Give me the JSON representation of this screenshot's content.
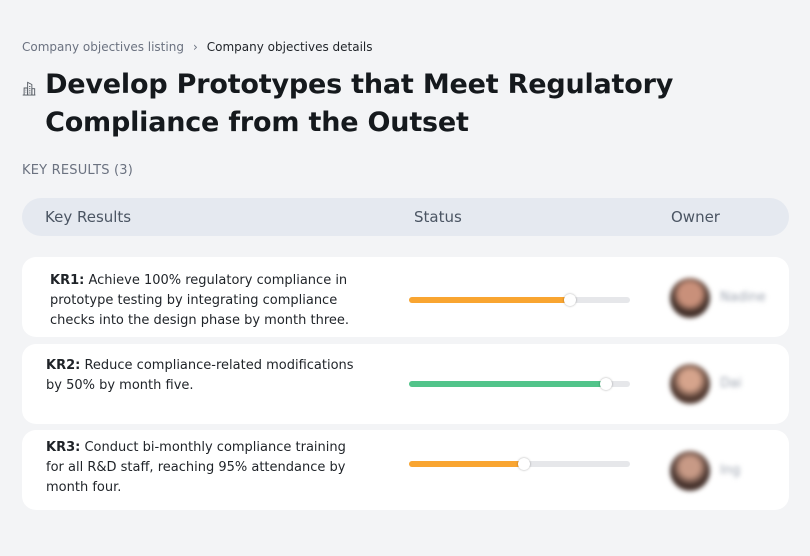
{
  "breadcrumb": {
    "parent": "Company objectives listing",
    "separator": "›",
    "current": "Company objectives details"
  },
  "objective": {
    "icon": "buildings-icon",
    "title": "Develop Prototypes that Meet Regulatory Compliance from the Outset"
  },
  "key_results_label": "KEY RESULTS (3)",
  "table": {
    "headers": {
      "key_results": "Key Results",
      "status": "Status",
      "owner": "Owner"
    },
    "rows": [
      {
        "id": "KR1:",
        "text": "Achieve 100% regulatory compliance in prototype testing by integrating compliance checks into the design phase by month three.",
        "progress": 0.73,
        "status_color": "#f9a531",
        "owner": "Nadine"
      },
      {
        "id": "KR2:",
        "text": "Reduce compliance-related modifications by 50% by month five.",
        "progress": 0.89,
        "status_color": "#52c48a",
        "owner": "Dai"
      },
      {
        "id": "KR3:",
        "text": "Conduct bi-monthly compliance training for all R&D staff, reaching 95% attendance by month four.",
        "progress": 0.52,
        "status_color": "#f9a531",
        "owner": "Ing"
      }
    ]
  }
}
